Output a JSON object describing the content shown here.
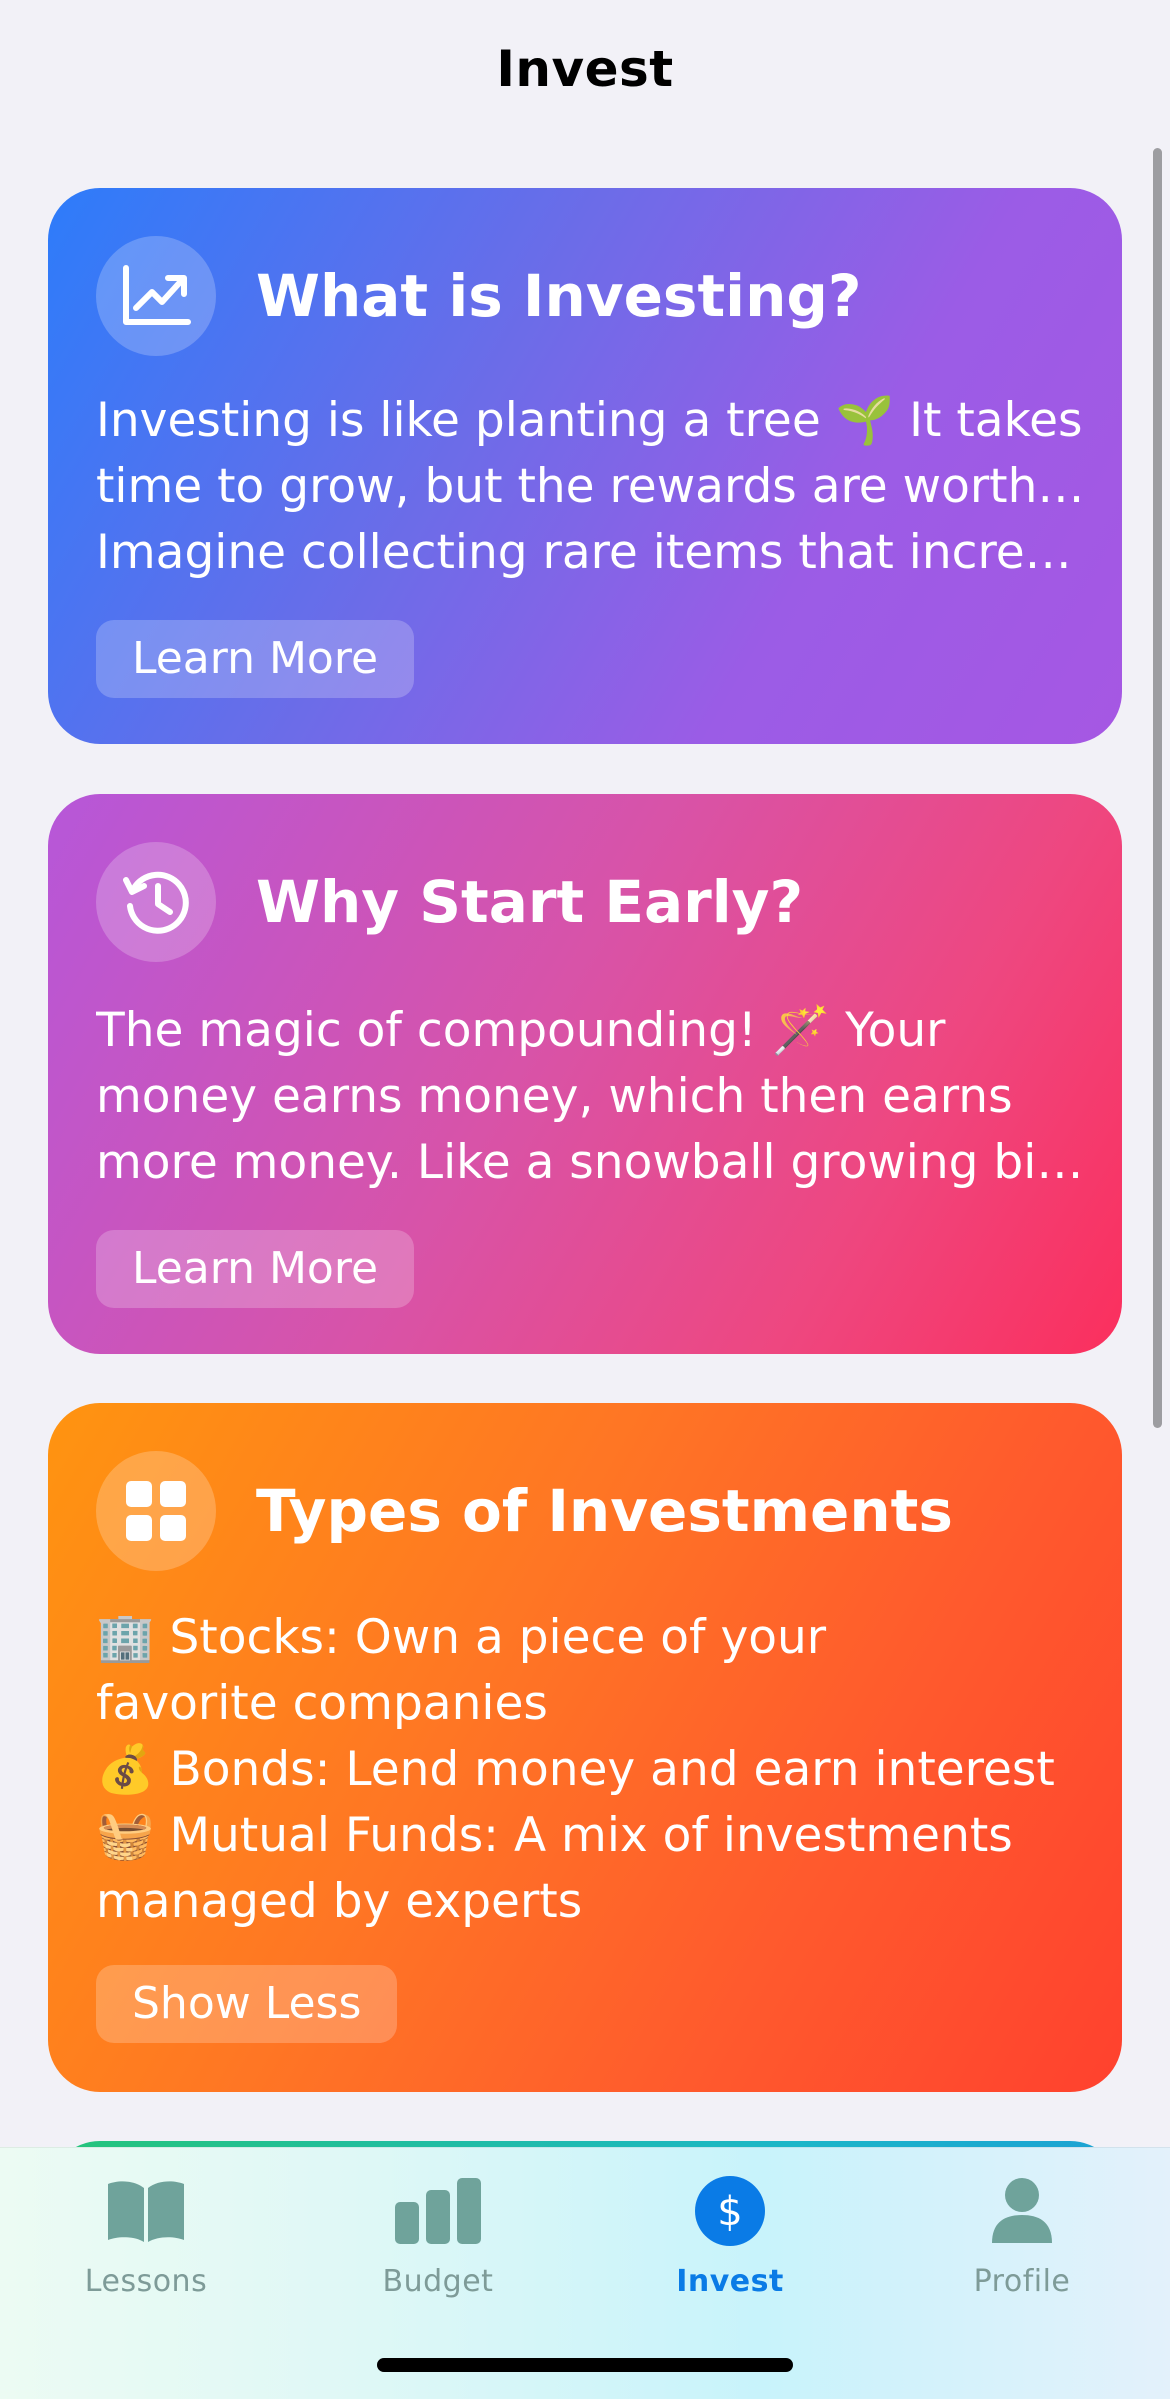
{
  "nav": {
    "title": "Invest"
  },
  "cards": [
    {
      "icon": "chart-line-uptrend-icon",
      "title": "What is Investing?",
      "lines": [
        "Investing is like planting a tree 🌱 It takes",
        "time to grow, but the rewards are worth it!",
        "Imagine collecting rare items that increas..."
      ],
      "button": "Learn More"
    },
    {
      "icon": "clock-history-icon",
      "title": "Why Start Early?",
      "lines": [
        "The magic of compounding! 🪄 Your",
        "money earns money, which then earns",
        "more money. Like a snowball growing big..."
      ],
      "button": "Learn More"
    },
    {
      "icon": "grid-squares-icon",
      "title": "Types of Investments",
      "lines": [
        "🏢 Stocks: Own a piece of your",
        "favorite companies",
        "💰 Bonds: Lend money and earn interest",
        "🧺 Mutual Funds: A mix of investments",
        "managed by experts"
      ],
      "button": "Show Less"
    }
  ],
  "tabbar": {
    "items": [
      {
        "label": "Lessons",
        "icon": "book-icon",
        "active": false
      },
      {
        "label": "Budget",
        "icon": "bar-chart-icon",
        "active": false
      },
      {
        "label": "Invest",
        "icon": "dollar-circle-icon",
        "active": true
      },
      {
        "label": "Profile",
        "icon": "person-icon",
        "active": false
      }
    ]
  },
  "colors": {
    "active_tab": "#0a7be6",
    "inactive_tab": "#7e9b98",
    "card1": "#6c6ce8",
    "card2": "#ee4780",
    "card3": "#ff6a28"
  }
}
